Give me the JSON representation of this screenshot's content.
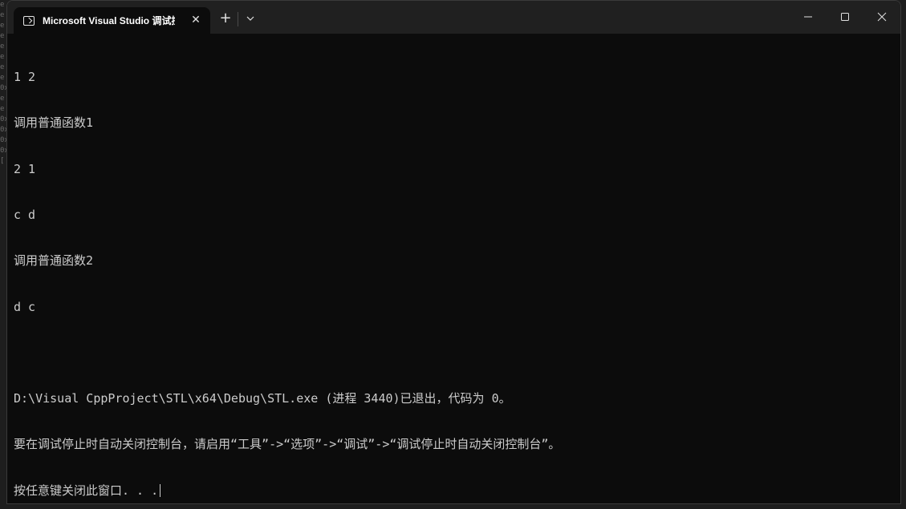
{
  "background": {
    "partial_text": [
      "e",
      "e",
      "e",
      "e",
      "e",
      "e",
      "e",
      "e",
      "0x",
      "e",
      "e",
      "0x",
      "0x",
      "0x",
      "0x",
      "[ "
    ]
  },
  "window": {
    "tab_title": "Microsoft Visual Studio 调试控制台",
    "tab_icon": "terminal-icon",
    "close_tab_glyph": "✕",
    "new_tab_glyph": "+",
    "controls": {
      "minimize_icon": "minimize-icon",
      "maximize_icon": "maximize-icon",
      "close_icon": "close-icon"
    }
  },
  "console": {
    "lines": [
      "1 2",
      "调用普通函数1",
      "2 1",
      "c d",
      "调用普通函数2",
      "d c",
      "",
      "D:\\Visual CppProject\\STL\\x64\\Debug\\STL.exe (进程 3440)已退出，代码为 0。",
      "要在调试停止时自动关闭控制台，请启用“工具”->“选项”->“调试”->“调试停止时自动关闭控制台”。",
      "按任意键关闭此窗口. . ."
    ]
  },
  "colors": {
    "console_bg": "#0c0c0c",
    "console_fg": "#cccccc",
    "titlebar_bg": "#202020"
  }
}
